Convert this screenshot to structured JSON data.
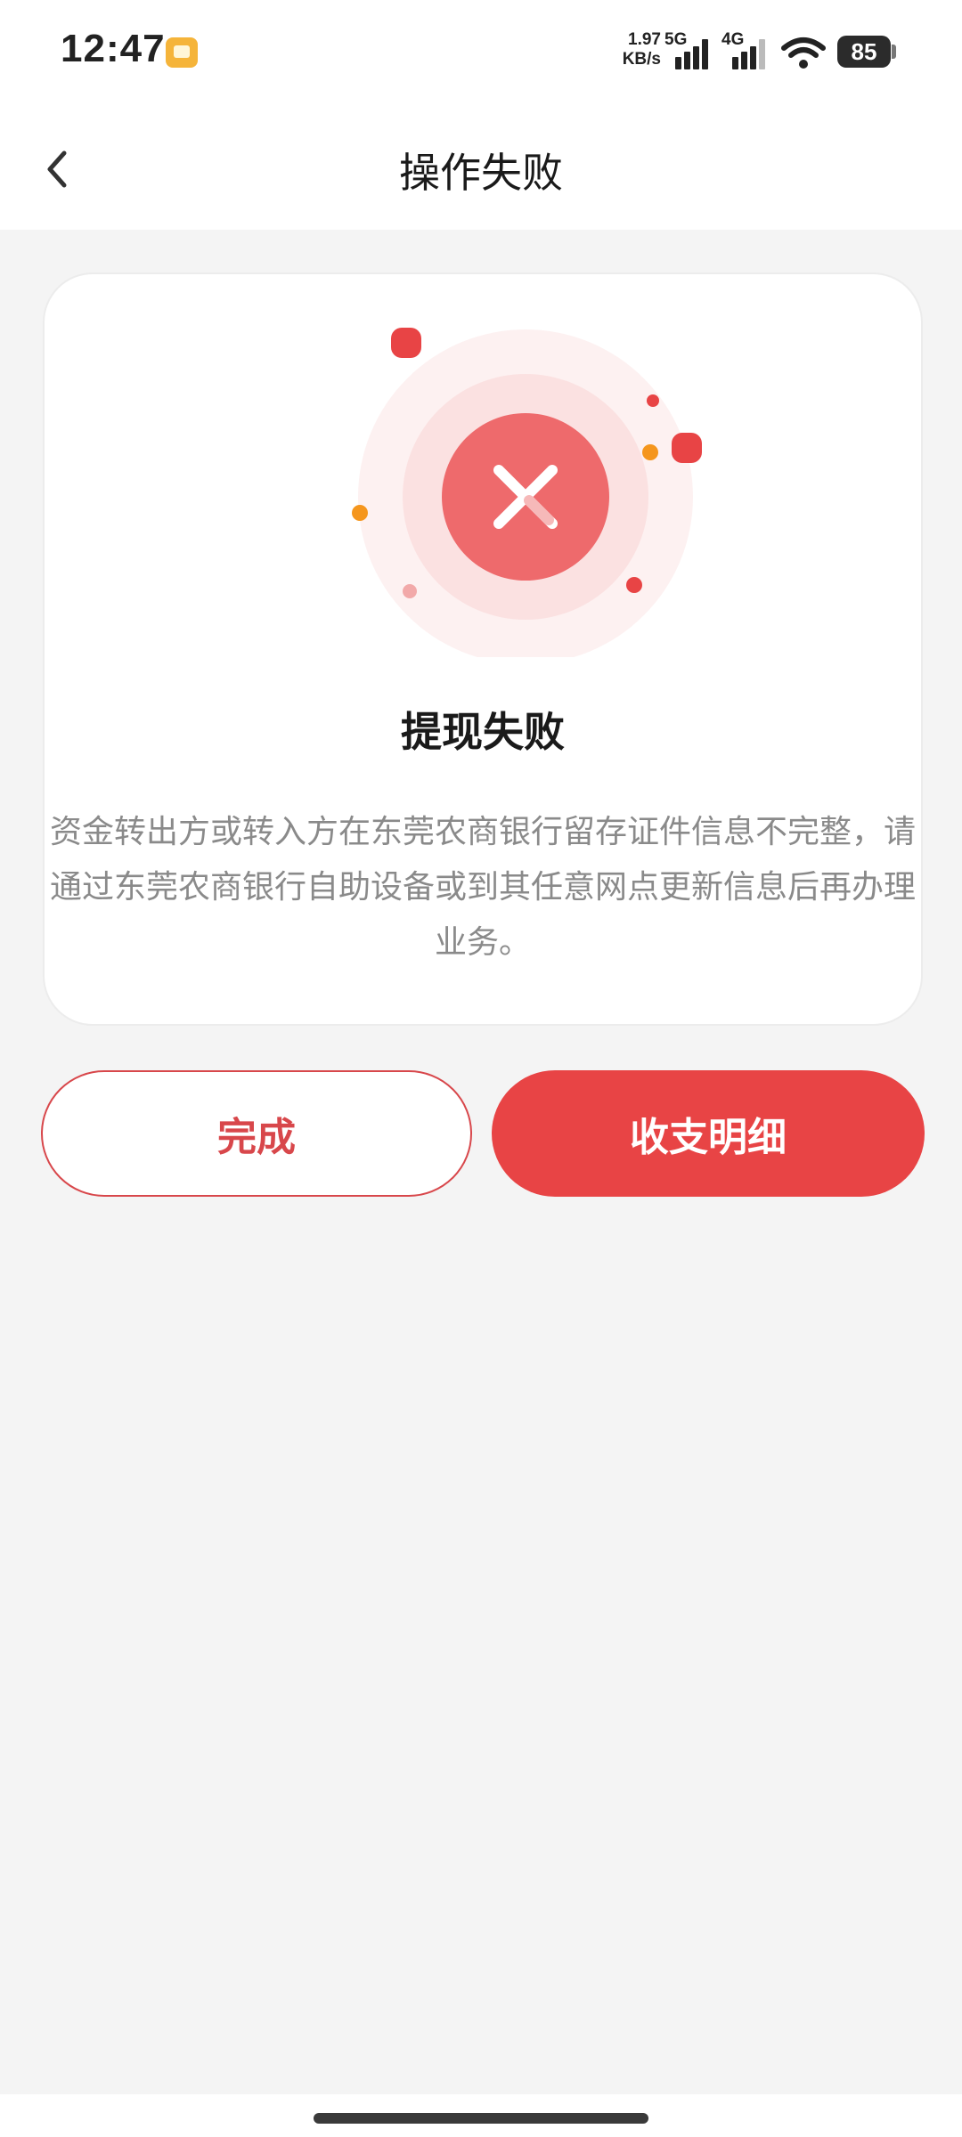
{
  "status_bar": {
    "time": "12:47",
    "net_speed_value": "1.97",
    "net_speed_unit": "KB/s",
    "signal_1_label": "5G",
    "signal_2_label": "4G",
    "battery": "85"
  },
  "header": {
    "title": "操作失败"
  },
  "result": {
    "title": "提现失败",
    "message": "资金转出方或转入方在东莞农商银行留存证件信息不完整，请通过东莞农商银行自助设备或到其任意网点更新信息后再办理业务。"
  },
  "actions": {
    "done_label": "完成",
    "detail_label": "收支明细"
  },
  "colors": {
    "accent": "#e84445",
    "background": "#f4f4f4",
    "card": "#ffffff"
  }
}
